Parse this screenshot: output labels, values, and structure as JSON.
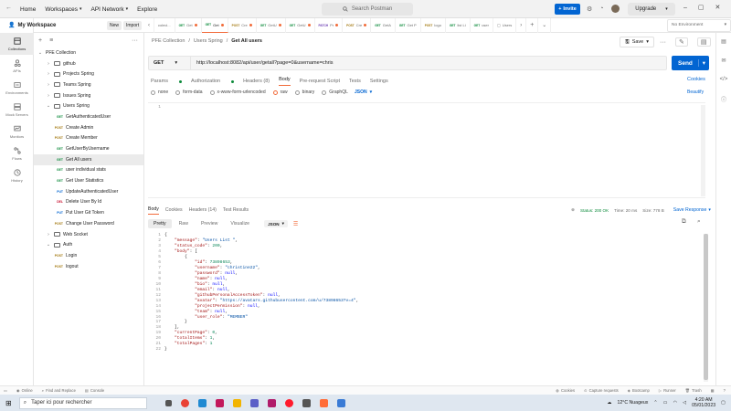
{
  "topbar": {
    "nav": [
      "Home",
      "Workspaces",
      "API Network",
      "Explore"
    ],
    "search_placeholder": "Search Postman",
    "invite_label": "Invite",
    "upgrade_label": "Upgrade"
  },
  "workspace": {
    "name": "My Workspace",
    "new_label": "New",
    "import_label": "Import"
  },
  "rail": [
    {
      "label": "Collections",
      "icon": "collections-icon"
    },
    {
      "label": "APIs",
      "icon": "apis-icon"
    },
    {
      "label": "Environments",
      "icon": "environments-icon"
    },
    {
      "label": "Mock Servers",
      "icon": "mock-servers-icon"
    },
    {
      "label": "Monitors",
      "icon": "monitors-icon"
    },
    {
      "label": "Flows",
      "icon": "flows-icon"
    },
    {
      "label": "History",
      "icon": "history-icon"
    }
  ],
  "tree": [
    {
      "kind": "collection",
      "label": "PFE Collection",
      "depth": 0,
      "open": true
    },
    {
      "kind": "folder",
      "label": "github",
      "depth": 1
    },
    {
      "kind": "folder",
      "label": "Projects Spring",
      "depth": 1
    },
    {
      "kind": "folder",
      "label": "Teams Spring",
      "depth": 1
    },
    {
      "kind": "folder",
      "label": "Issues Spring",
      "depth": 1
    },
    {
      "kind": "folder",
      "label": "Users Spring",
      "depth": 1,
      "open": true
    },
    {
      "kind": "request",
      "method": "GET",
      "label": "GetAuthenticatedUser",
      "depth": 2
    },
    {
      "kind": "request",
      "method": "POST",
      "label": "Create Admin",
      "depth": 2
    },
    {
      "kind": "request",
      "method": "POST",
      "label": "Create Member",
      "depth": 2
    },
    {
      "kind": "request",
      "method": "GET",
      "label": "GetUserByUsername",
      "depth": 2
    },
    {
      "kind": "request",
      "method": "GET",
      "label": "Get All users",
      "depth": 2,
      "selected": true
    },
    {
      "kind": "request",
      "method": "GET",
      "label": "user individual stats",
      "depth": 2
    },
    {
      "kind": "request",
      "method": "GET",
      "label": "Get User Statistics",
      "depth": 2
    },
    {
      "kind": "request",
      "method": "PUT",
      "label": "UpdateAuthenticatedUser",
      "depth": 2
    },
    {
      "kind": "request",
      "method": "DEL",
      "label": "Delete User By Id",
      "depth": 2
    },
    {
      "kind": "request",
      "method": "PUT",
      "label": "Put User Git Token",
      "depth": 2
    },
    {
      "kind": "request",
      "method": "POST",
      "label": "Change User Password",
      "depth": 2
    },
    {
      "kind": "folder",
      "label": "Web Socket",
      "depth": 1
    },
    {
      "kind": "folder",
      "label": "Auth",
      "depth": 1,
      "open": true
    },
    {
      "kind": "request",
      "method": "POST",
      "label": "Login",
      "depth": 2
    },
    {
      "kind": "request",
      "method": "POST",
      "label": "logout",
      "depth": 2
    }
  ],
  "tabs": [
    {
      "method": "GET",
      "label": "Get",
      "dot": true
    },
    {
      "method": "GET",
      "label": "Get",
      "dot": true,
      "active": true
    },
    {
      "method": "POST",
      "label": "Cre",
      "dot": true
    },
    {
      "method": "GET",
      "label": "GetU",
      "dot": true
    },
    {
      "method": "GET",
      "label": "GetU",
      "dot": true
    },
    {
      "method": "PATCH",
      "label": "Pr",
      "dot": true
    },
    {
      "method": "POST",
      "label": "Cre",
      "dot": true
    },
    {
      "method": "GET",
      "label": "GetA",
      "dot": false
    },
    {
      "method": "GET",
      "label": "Get P",
      "dot": false
    },
    {
      "method": "POST",
      "label": "logo",
      "dot": false
    },
    {
      "method": "GET",
      "label": "list Li",
      "dot": false
    },
    {
      "method": "GET",
      "label": "user",
      "dot": false
    },
    {
      "method": "",
      "label": "Users",
      "dot": false
    }
  ],
  "environment": "No Environment",
  "breadcrumb": [
    "PFE Collection",
    "Users Spring",
    "Get All users"
  ],
  "save_label": "Save",
  "request": {
    "method": "GET",
    "url": "http://localhost:8082/api/user/getall?page=0&username=chris",
    "send_label": "Send",
    "tabs": [
      "Params",
      "Authorization",
      "Headers (8)",
      "Body",
      "Pre-request Script",
      "Tests",
      "Settings"
    ],
    "active_tab": "Body",
    "cookies_label": "Cookies",
    "body_types": [
      "none",
      "form-data",
      "x-www-form-urlencoded",
      "raw",
      "binary",
      "GraphQL"
    ],
    "body_selected": "raw",
    "format": "JSON",
    "beautify_label": "Beautify",
    "editor_line": "1"
  },
  "response": {
    "tabs": [
      "Body",
      "Cookies",
      "Headers (14)",
      "Test Results"
    ],
    "status": "Status: 200 OK",
    "time": "Time: 20 ms",
    "size": "Size: 778 B",
    "save_label": "Save Response",
    "view_tabs": [
      "Pretty",
      "Raw",
      "Preview",
      "Visualize"
    ],
    "format": "JSON",
    "lines": [
      "{",
      "    \"message\": \"Users List \",",
      "    \"status_code\": 200,",
      "    \"body\": [",
      "        {",
      "            \"id\": 73898653,",
      "            \"username\": \"christine22\",",
      "            \"password\": null,",
      "            \"name\": null,",
      "            \"bio\": null,",
      "            \"email\": null,",
      "            \"githubPersonalAccessToken\": null,",
      "            \"avatar\": \"https://avatars.githubusercontent.com/u/73898653?v=4\",",
      "            \"projectPermission\": null,",
      "            \"team\": null,",
      "            \"user_role\": \"MEMBER\"",
      "        }",
      "    ],",
      "    \"currentPage\": 0,",
      "    \"totalItems\": 1,",
      "    \"totalPages\": 1",
      "}"
    ]
  },
  "statusbar": {
    "left": [
      "Online",
      "Find and Replace",
      "Console"
    ],
    "right": [
      "Cookies",
      "Capture requests",
      "Bootcamp",
      "Runner",
      "Trash"
    ]
  },
  "taskbar": {
    "search_placeholder": "Taper ici pour rechercher",
    "weather": "12°C Nuageux",
    "time": "4:20 AM",
    "date": "05/01/2023"
  },
  "colors": {
    "accent": "#f26b3a",
    "send": "#0265d2",
    "get": "#0b8a3a",
    "post": "#a2770d",
    "put": "#0265d2",
    "del": "#c8102e",
    "patch": "#6a3bb3"
  }
}
